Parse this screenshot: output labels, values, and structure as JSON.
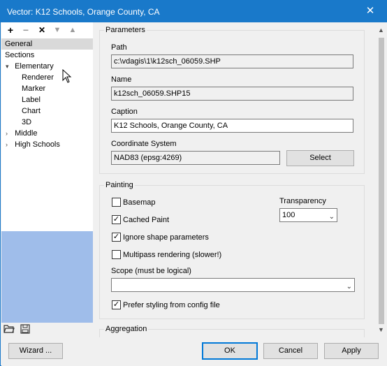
{
  "window": {
    "title": "Vector: K12 Schools, Orange County, CA",
    "close_glyph": "✕"
  },
  "toolbar": {
    "add": "+",
    "remove": "−",
    "delete": "✕",
    "move_down": "▼",
    "move_up": "▲"
  },
  "tree": {
    "items": [
      {
        "label": "General"
      },
      {
        "label": "Sections"
      },
      {
        "label": "Elementary",
        "arrow": "▾"
      },
      {
        "label": "Renderer"
      },
      {
        "label": "Marker"
      },
      {
        "label": "Label"
      },
      {
        "label": "Chart"
      },
      {
        "label": "3D"
      },
      {
        "label": "Middle",
        "arrow": "›"
      },
      {
        "label": "High Schools",
        "arrow": "›"
      }
    ]
  },
  "bottom_icons": {
    "open": "open-folder-icon",
    "save": "save-icon"
  },
  "parameters": {
    "group_label": "Parameters",
    "path_label": "Path",
    "path_value": "c:\\vdagis\\1\\k12sch_06059.SHP",
    "name_label": "Name",
    "name_value": "k12sch_06059.SHP15",
    "caption_label": "Caption",
    "caption_value": "K12 Schools, Orange County, CA",
    "cs_label": "Coordinate System",
    "cs_value": "NAD83 (epsg:4269)",
    "select_button": "Select"
  },
  "painting": {
    "group_label": "Painting",
    "basemap": {
      "label": "Basemap",
      "checked": false
    },
    "cached_paint": {
      "label": "Cached Paint",
      "checked": true
    },
    "ignore_shape": {
      "label": "Ignore shape parameters",
      "checked": true
    },
    "multipass": {
      "label": "Multipass rendering (slower!)",
      "checked": false
    },
    "transparency_label": "Transparency",
    "transparency_value": "100",
    "scope_label": "Scope (must be logical)",
    "scope_value": "",
    "prefer_styling": {
      "label": "Prefer styling from config file",
      "checked": true
    }
  },
  "aggregation": {
    "group_label": "Aggregation"
  },
  "footer": {
    "wizard": "Wizard ...",
    "ok": "OK",
    "cancel": "Cancel",
    "apply": "Apply"
  },
  "colors": {
    "titlebar": "#1979ca",
    "selection_area": "#9fbdea",
    "primary_border": "#0078d7"
  }
}
